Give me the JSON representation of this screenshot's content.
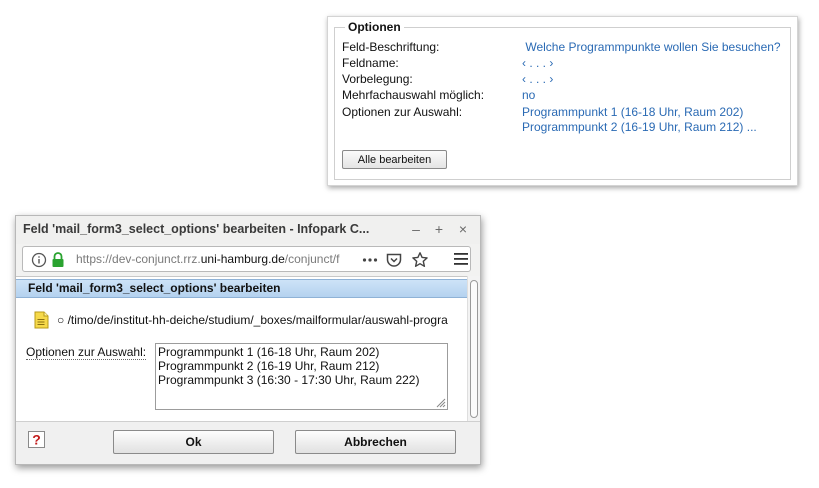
{
  "options_panel": {
    "legend": "Optionen",
    "rows": [
      {
        "label": "Feld-Beschriftung:",
        "value": " Welche Programmpunkte wollen Sie besuchen?"
      },
      {
        "label": "Feldname:",
        "value": "‹ . . . ›"
      },
      {
        "label": "Vorbelegung:",
        "value": "‹ . . . ›"
      },
      {
        "label": "Mehrfachauswahl möglich:",
        "value": "no"
      },
      {
        "label": "Optionen zur Auswahl:",
        "value": "Programmpunkt 1 (16-18 Uhr, Raum 202)",
        "value2": "Programmpunkt 2 (16-19 Uhr, Raum 212) ..."
      }
    ],
    "edit_all_label": "Alle bearbeiten"
  },
  "popup": {
    "window_title": "Feld 'mail_form3_select_options' bearbeiten - Infopark C...",
    "controls": {
      "minimize": "–",
      "maximize": "+",
      "close": "×"
    },
    "url": {
      "prefix": "https://dev-conjunct.rrz.",
      "host": "uni-hamburg.de",
      "suffix": "/conjunct/f"
    },
    "dialog_title": "Feld 'mail_form3_select_options' bearbeiten",
    "path_bullet": "○",
    "path": "/timo/de/institut-hh-deiche/studium/_boxes/mailformular/auswahl-progra",
    "field_label": "Optionen zur Auswahl:",
    "textarea_lines": [
      "Programmpunkt 1 (16-18 Uhr, Raum 202)",
      "Programmpunkt 2 (16-19 Uhr, Raum 212)",
      "Programmpunkt 3 (16:30 - 17:30 Uhr, Raum 222)"
    ],
    "ok_label": "Ok",
    "cancel_label": "Abbrechen",
    "help_glyph": "?"
  },
  "icons": {
    "info": "info-icon",
    "lock": "lock-icon",
    "more": "more-icon",
    "pocket": "pocket-icon",
    "bookmark": "bookmark-star-icon",
    "menu": "hamburger-menu-icon",
    "document": "document-icon",
    "help": "help-icon"
  },
  "colors": {
    "link_blue": "#2a6ab4",
    "dialog_header": "#b4d2ef",
    "lock_green": "#2aa330"
  }
}
